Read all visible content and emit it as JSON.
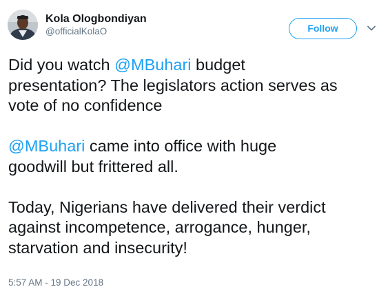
{
  "user": {
    "display_name": "Kola Ologbondiyan",
    "handle": "@officialKolaO"
  },
  "follow_button_label": "Follow",
  "icons": {
    "avatar": "user-avatar-photo",
    "caret": "chevron-down-icon"
  },
  "colors": {
    "accent": "#1da1f2",
    "text": "#14171a",
    "secondary": "#657786"
  },
  "tweet": {
    "p1": {
      "mention": "@MBuhari",
      "l1_pre": "Did you watch ",
      "l1_post": " budget",
      "l2": "presentation? The legislators action serves as",
      "l3": "vote of no confidence"
    },
    "p2": {
      "mention": "@MBuhari",
      "l1_post": " came into office with huge",
      "l2": "goodwill but frittered all."
    },
    "p3": {
      "l1": "Today, Nigerians have delivered their verdict",
      "l2": "against incompetence, arrogance, hunger,",
      "l3": "starvation and insecurity!"
    }
  },
  "timestamp": "5:57 AM - 19 Dec 2018"
}
